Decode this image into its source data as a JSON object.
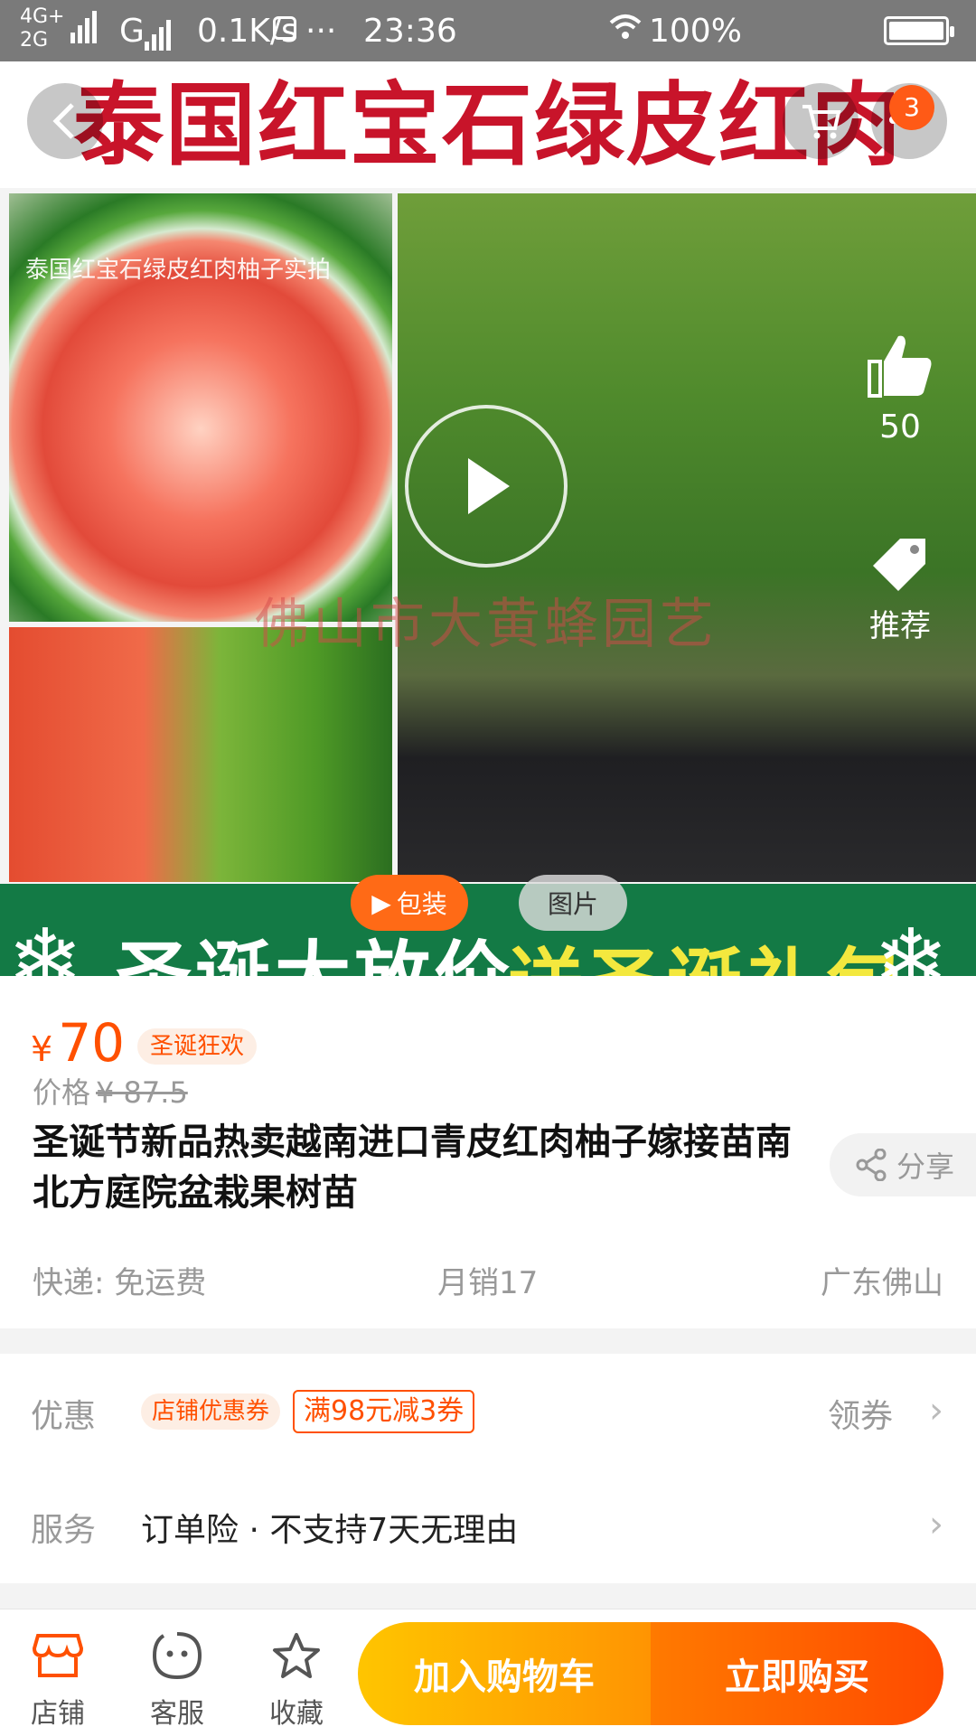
{
  "status_bar": {
    "net1": "4G+",
    "net2": "2G",
    "carrier": "G",
    "speed": "0.1K/s",
    "dots": "···",
    "time": "23:36",
    "battery": "100%",
    "battery_level": 1.0
  },
  "hero": {
    "title_text": "泰国红宝石绿皮红肉",
    "photo_caption": "泰国红宝石绿皮红肉柚子实拍",
    "watermark": "佛山市大黄蜂园艺",
    "banner_left": "圣诞大放价",
    "banner_right": "送圣诞礼包",
    "cart_count": "3",
    "like_count": "50",
    "recommend_label": "推荐",
    "video_label": "包装",
    "photo_label": "图片"
  },
  "product": {
    "currency": "¥",
    "price": "70",
    "promo_tag": "圣诞狂欢",
    "orig_label": "价格",
    "orig_price": "¥ 87.5",
    "title": "圣诞节新品热卖越南进口青皮红肉柚子嫁接苗南北方庭院盆栽果树苗",
    "share_label": "分享",
    "shipping": "快递: 免运费",
    "monthly_sales": "月销17",
    "location": "广东佛山"
  },
  "discount": {
    "label": "优惠",
    "tag": "店铺优惠券",
    "coupon": "满98元减3券",
    "action": "领券"
  },
  "service": {
    "label": "服务",
    "text": "订单险 · 不支持7天无理由"
  },
  "bottom_bar": {
    "shop": "店铺",
    "support": "客服",
    "favorite": "收藏",
    "add_cart": "加入购物车",
    "buy_now": "立即购买"
  },
  "colors": {
    "accent": "#ff5000",
    "cart_button": "#ffb000",
    "buy_button": "#ff5a00",
    "banner_green": "#137a45"
  }
}
